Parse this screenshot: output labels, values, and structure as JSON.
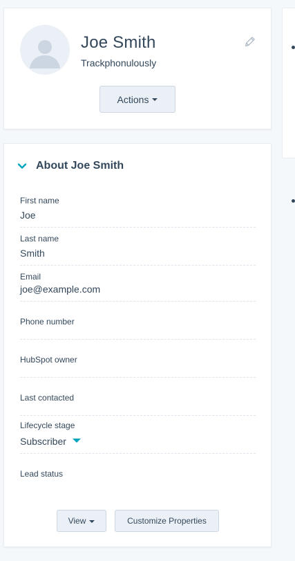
{
  "contact": {
    "name": "Joe Smith",
    "company": "Trackphonulously",
    "actions_label": "Actions"
  },
  "about": {
    "title": "About Joe Smith",
    "properties": [
      {
        "label": "First name",
        "value": "Joe"
      },
      {
        "label": "Last name",
        "value": "Smith"
      },
      {
        "label": "Email",
        "value": "joe@example.com"
      },
      {
        "label": "Phone number",
        "value": ""
      },
      {
        "label": "HubSpot owner",
        "value": ""
      },
      {
        "label": "Last contacted",
        "value": ""
      },
      {
        "label": "Lifecycle stage",
        "value": "Subscriber"
      },
      {
        "label": "Lead status",
        "value": ""
      }
    ],
    "view_label": "View",
    "customize_label": "Customize Properties"
  },
  "icons": {
    "avatar": "avatar-placeholder-icon",
    "edit": "pencil-icon",
    "collapse": "chevron-down-icon",
    "lifecycle_dropdown": "caret-down-icon"
  },
  "colors": {
    "background": "#f5f8fa",
    "text": "#33475b",
    "accent": "#00a4bd",
    "button_bg": "#eaf0f6",
    "border": "#cbd6e2"
  }
}
